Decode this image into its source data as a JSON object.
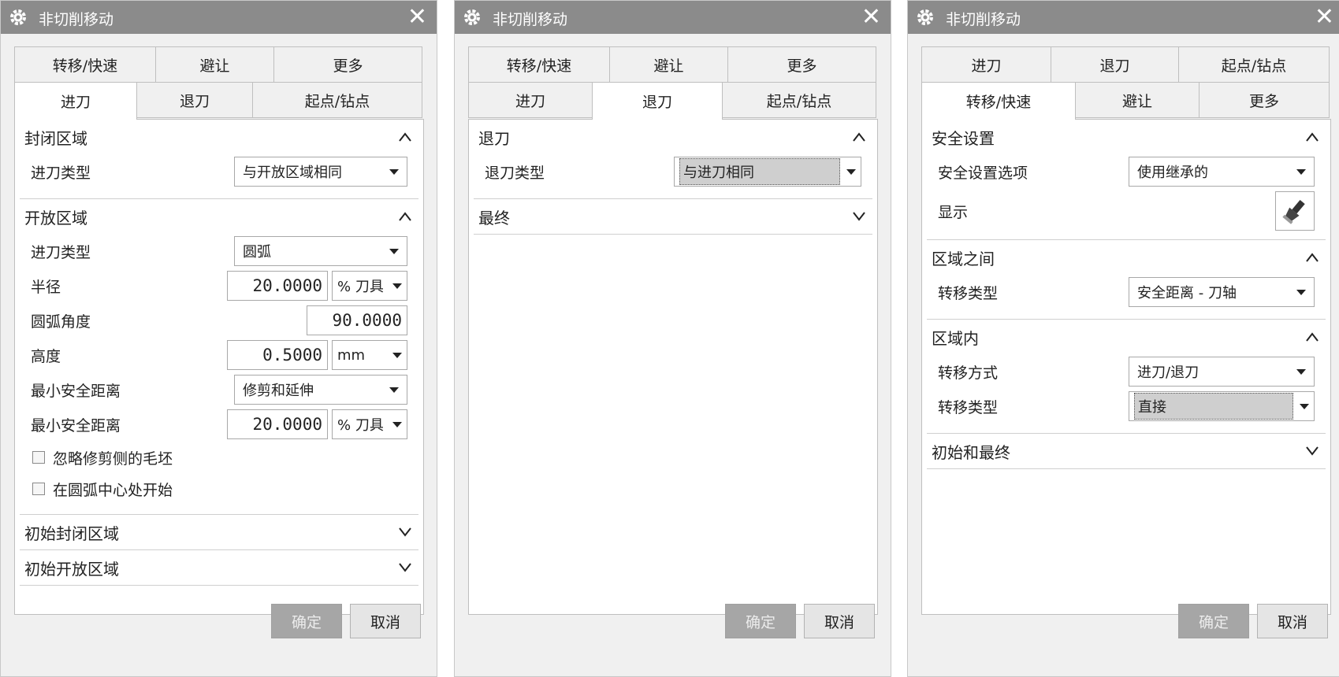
{
  "dialog_title": "非切削移动",
  "buttons": {
    "ok": "确定",
    "cancel": "取消"
  },
  "tab_labels": {
    "transfer": "转移/快速",
    "avoid": "避让",
    "more": "更多",
    "engage": "进刀",
    "retract": "退刀",
    "start": "起点/钻点"
  },
  "d1": {
    "closed_area": {
      "title": "封闭区域",
      "engage_type_label": "进刀类型",
      "engage_type_value": "与开放区域相同"
    },
    "open_area": {
      "title": "开放区域",
      "engage_type_label": "进刀类型",
      "engage_type_value": "圆弧",
      "radius_label": "半径",
      "radius_value": "20.0000",
      "radius_unit": "% 刀具",
      "arc_angle_label": "圆弧角度",
      "arc_angle_value": "90.0000",
      "height_label": "高度",
      "height_value": "0.5000",
      "height_unit": "mm",
      "min_clear_label_1": "最小安全距离",
      "min_clear_value_1": "修剪和延伸",
      "min_clear_label_2": "最小安全距离",
      "min_clear_value_2": "20.0000",
      "min_clear_unit_2": "% 刀具",
      "chk_ignore": "忽略修剪侧的毛坯",
      "chk_center": "在圆弧中心处开始"
    },
    "initial_closed": "初始封闭区域",
    "initial_open": "初始开放区域"
  },
  "d2": {
    "retract": {
      "title": "退刀",
      "type_label": "退刀类型",
      "type_value": "与进刀相同"
    },
    "final": "最终"
  },
  "d3": {
    "safety": {
      "title": "安全设置",
      "option_label": "安全设置选项",
      "option_value": "使用继承的",
      "display_label": "显示"
    },
    "between": {
      "title": "区域之间",
      "type_label": "转移类型",
      "type_value": "安全距离 - 刀轴"
    },
    "within": {
      "title": "区域内",
      "method_label": "转移方式",
      "method_value": "进刀/退刀",
      "type_label": "转移类型",
      "type_value": "直接"
    },
    "initial_final": "初始和最终"
  }
}
